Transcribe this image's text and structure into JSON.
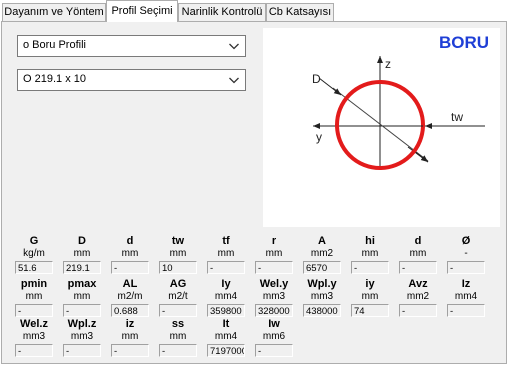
{
  "tabs": [
    "Dayanım ve Yöntem",
    "Profil Seçimi",
    "Narinlik Kontrolü",
    "Cb Katsayısı"
  ],
  "selects": {
    "profile_type": "o Boru Profili",
    "section": "O 219.1 x 10"
  },
  "diagram": {
    "title": "BORU",
    "label_d": "D",
    "label_z": "z",
    "label_y": "y",
    "label_tw": "tw",
    "title_color": "#1f3fd6",
    "ring_color": "#e31b1b"
  },
  "properties": [
    [
      {
        "label": "G",
        "unit": "kg/m",
        "value": "51.6"
      },
      {
        "label": "D",
        "unit": "mm",
        "value": "219.1"
      },
      {
        "label": "d",
        "unit": "mm",
        "value": "-"
      },
      {
        "label": "tw",
        "unit": "mm",
        "value": "10"
      },
      {
        "label": "tf",
        "unit": "mm",
        "value": "-"
      },
      {
        "label": "r",
        "unit": "mm",
        "value": "-"
      },
      {
        "label": "A",
        "unit": "mm2",
        "value": "6570"
      },
      {
        "label": "hi",
        "unit": "mm",
        "value": "-"
      },
      {
        "label": "d",
        "unit": "mm",
        "value": "-"
      },
      {
        "label": "Ø",
        "unit": "-",
        "value": "-"
      }
    ],
    [
      {
        "label": "pmin",
        "unit": "mm",
        "value": "-"
      },
      {
        "label": "pmax",
        "unit": "mm",
        "value": "-"
      },
      {
        "label": "AL",
        "unit": "m2/m",
        "value": "0.688"
      },
      {
        "label": "AG",
        "unit": "m2/t",
        "value": "-"
      },
      {
        "label": "Iy",
        "unit": "mm4",
        "value": "359800"
      },
      {
        "label": "Wel.y",
        "unit": "mm3",
        "value": "328000"
      },
      {
        "label": "Wpl.y",
        "unit": "mm3",
        "value": "438000"
      },
      {
        "label": "iy",
        "unit": "mm",
        "value": "74"
      },
      {
        "label": "Avz",
        "unit": "mm2",
        "value": "-"
      },
      {
        "label": "Iz",
        "unit": "mm4",
        "value": "-"
      }
    ],
    [
      {
        "label": "Wel.z",
        "unit": "mm3",
        "value": "-"
      },
      {
        "label": "Wpl.z",
        "unit": "mm3",
        "value": "-"
      },
      {
        "label": "iz",
        "unit": "mm",
        "value": "-"
      },
      {
        "label": "ss",
        "unit": "mm",
        "value": "-"
      },
      {
        "label": "It",
        "unit": "mm4",
        "value": "7197000"
      },
      {
        "label": "Iw",
        "unit": "mm6",
        "value": "-"
      }
    ]
  ]
}
